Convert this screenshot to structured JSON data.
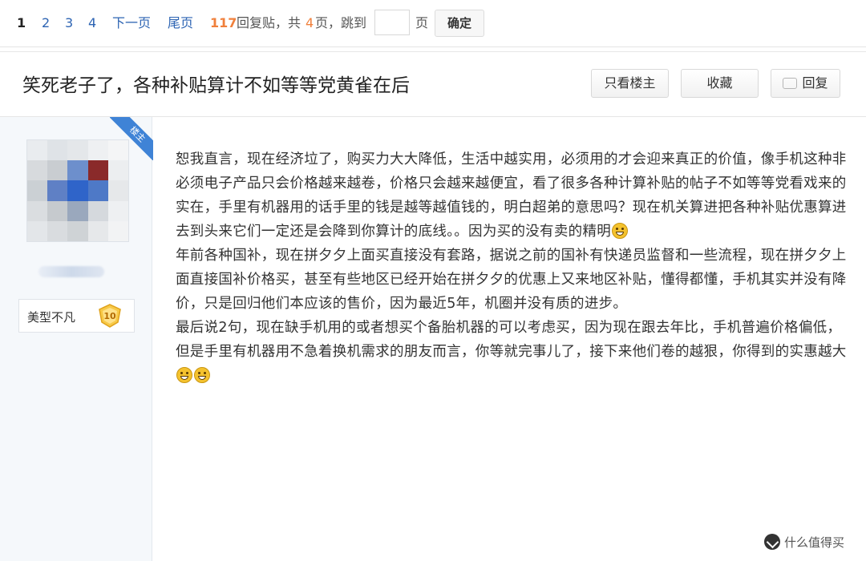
{
  "pager": {
    "current": "1",
    "pages": [
      "2",
      "3",
      "4"
    ],
    "next": "下一页",
    "last": "尾页",
    "reply_count": "117",
    "reply_label": "回复贴，共",
    "total_pages": "4",
    "pages_suffix": "页，跳到",
    "jump_value": "",
    "page_unit": "页",
    "confirm": "确定"
  },
  "topic": {
    "title": "笑死老子了，各种补贴算计不如等等党黄雀在后",
    "only_op": "只看楼主",
    "favorite": "收藏",
    "reply": "回复"
  },
  "author": {
    "owner_tag": "楼主",
    "level_name": "美型不凡",
    "level": "10"
  },
  "post": {
    "p1": "恕我直言，现在经济垃了，购买力大大降低，生活中越实用，必须用的才会迎来真正的价值，像手机这种非必须电子产品只会价格越来越卷，价格只会越来越便宜，看了很多各种计算补贴的帖子不如等等党看戏来的实在，手里有机器用的话手里的钱是越等越值钱的，明白超弟的意思吗？现在机关算进把各种补贴优惠算进去到头来它们一定还是会降到你算计的底线。。因为买的没有卖的精明",
    "p2": "年前各种国补，现在拼夕夕上面买直接没有套路，据说之前的国补有快递员监督和一些流程，现在拼夕夕上面直接国补价格买，甚至有些地区已经开始在拼夕夕的优惠上又来地区补贴，懂得都懂，手机其实并没有降价，只是回归他们本应该的售价，因为最近5年，机圈并没有质的进步。",
    "p3": "最后说2句，现在缺手机用的或者想买个备胎机器的可以考虑买，因为现在跟去年比，手机普遍价格偏低，但是手里有机器用不急着换机需求的朋友而言，你等就完事儿了，接下来他们卷的越狠，你得到的实惠越大"
  },
  "watermark": "什么值得买",
  "colors": {
    "link": "#2d64b3",
    "accent": "#f0803c",
    "owner_tag": "#3f83d6"
  }
}
